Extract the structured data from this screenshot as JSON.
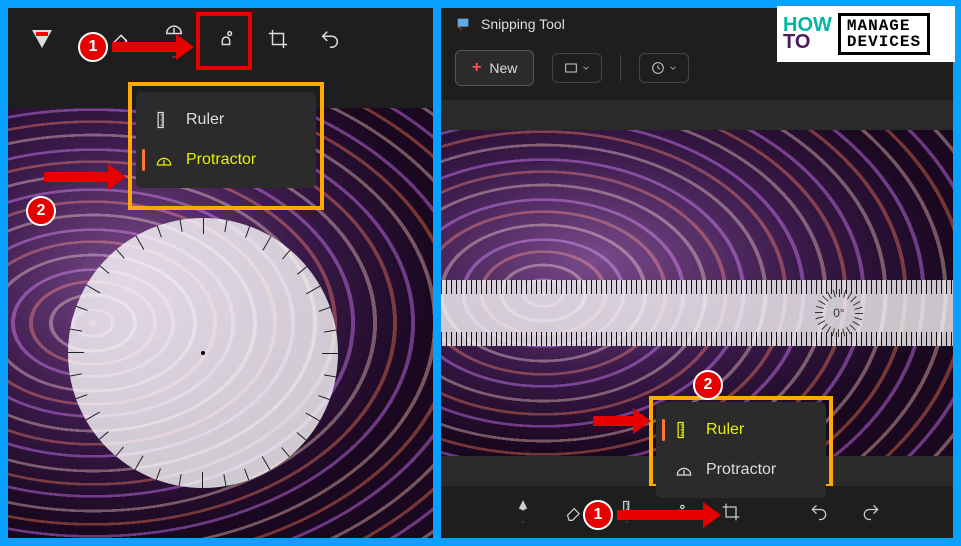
{
  "left": {
    "menu": {
      "ruler_label": "Ruler",
      "protractor_label": "Protractor"
    },
    "badge1": "1",
    "badge2": "2"
  },
  "right": {
    "app_title": "Snipping Tool",
    "new_button": "New",
    "menu": {
      "ruler_label": "Ruler",
      "protractor_label": "Protractor"
    },
    "angle": "0°",
    "badge1": "1",
    "badge2": "2"
  },
  "logo": {
    "line1": "HOW",
    "line2": "TO",
    "brand1": "MANAGE",
    "brand2": "DEVICES"
  }
}
